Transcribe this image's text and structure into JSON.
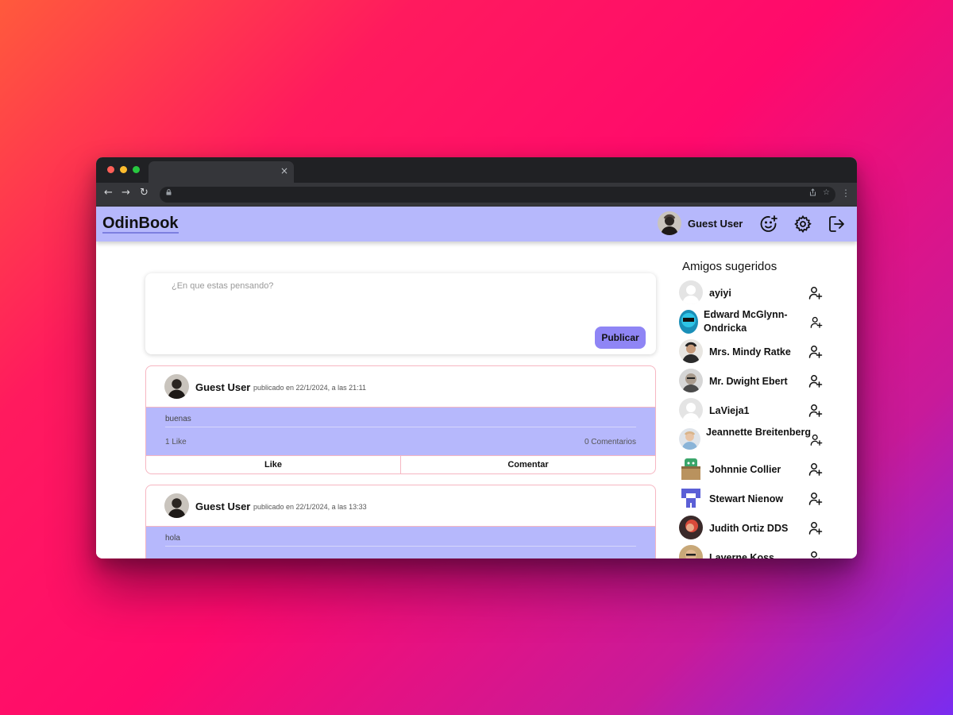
{
  "browser": {
    "traffic_light_colors": [
      "#ff5f57",
      "#febc2e",
      "#28c840"
    ],
    "tab_close": "×",
    "nav_back": "←",
    "nav_forward": "→",
    "nav_reload": "↻",
    "menu": "⋮"
  },
  "header": {
    "logo": "OdinBook",
    "user_name": "Guest User",
    "icons": [
      "add-friend-smiley-icon",
      "gear-icon",
      "logout-icon"
    ],
    "background": "#b6b8fc"
  },
  "composer": {
    "placeholder": "¿En que estas pensando?",
    "publish_label": "Publicar",
    "accent": "#8f85f5"
  },
  "posts": [
    {
      "author": "Guest User",
      "meta": "publicado en 22/1/2024, a las 21:11",
      "text": "buenas",
      "likes": "1 Like",
      "comments": "0 Comentarios",
      "like_label": "Like",
      "comment_label": "Comentar"
    },
    {
      "author": "Guest User",
      "meta": "publicado en 22/1/2024, a las 13:33",
      "text": "hola"
    }
  ],
  "sidebar": {
    "title": "Amigos sugeridos",
    "friends": [
      {
        "name": "ayiyi"
      },
      {
        "name": "Edward McGlynn-Ondricka"
      },
      {
        "name": "Mrs. Mindy Ratke"
      },
      {
        "name": "Mr. Dwight Ebert"
      },
      {
        "name": "LaVieja1"
      },
      {
        "name": "Jeannette Breitenberg"
      },
      {
        "name": "Johnnie Collier"
      },
      {
        "name": "Stewart Nienow"
      },
      {
        "name": "Judith Ortiz DDS"
      },
      {
        "name": "Laverne Koss"
      }
    ]
  }
}
